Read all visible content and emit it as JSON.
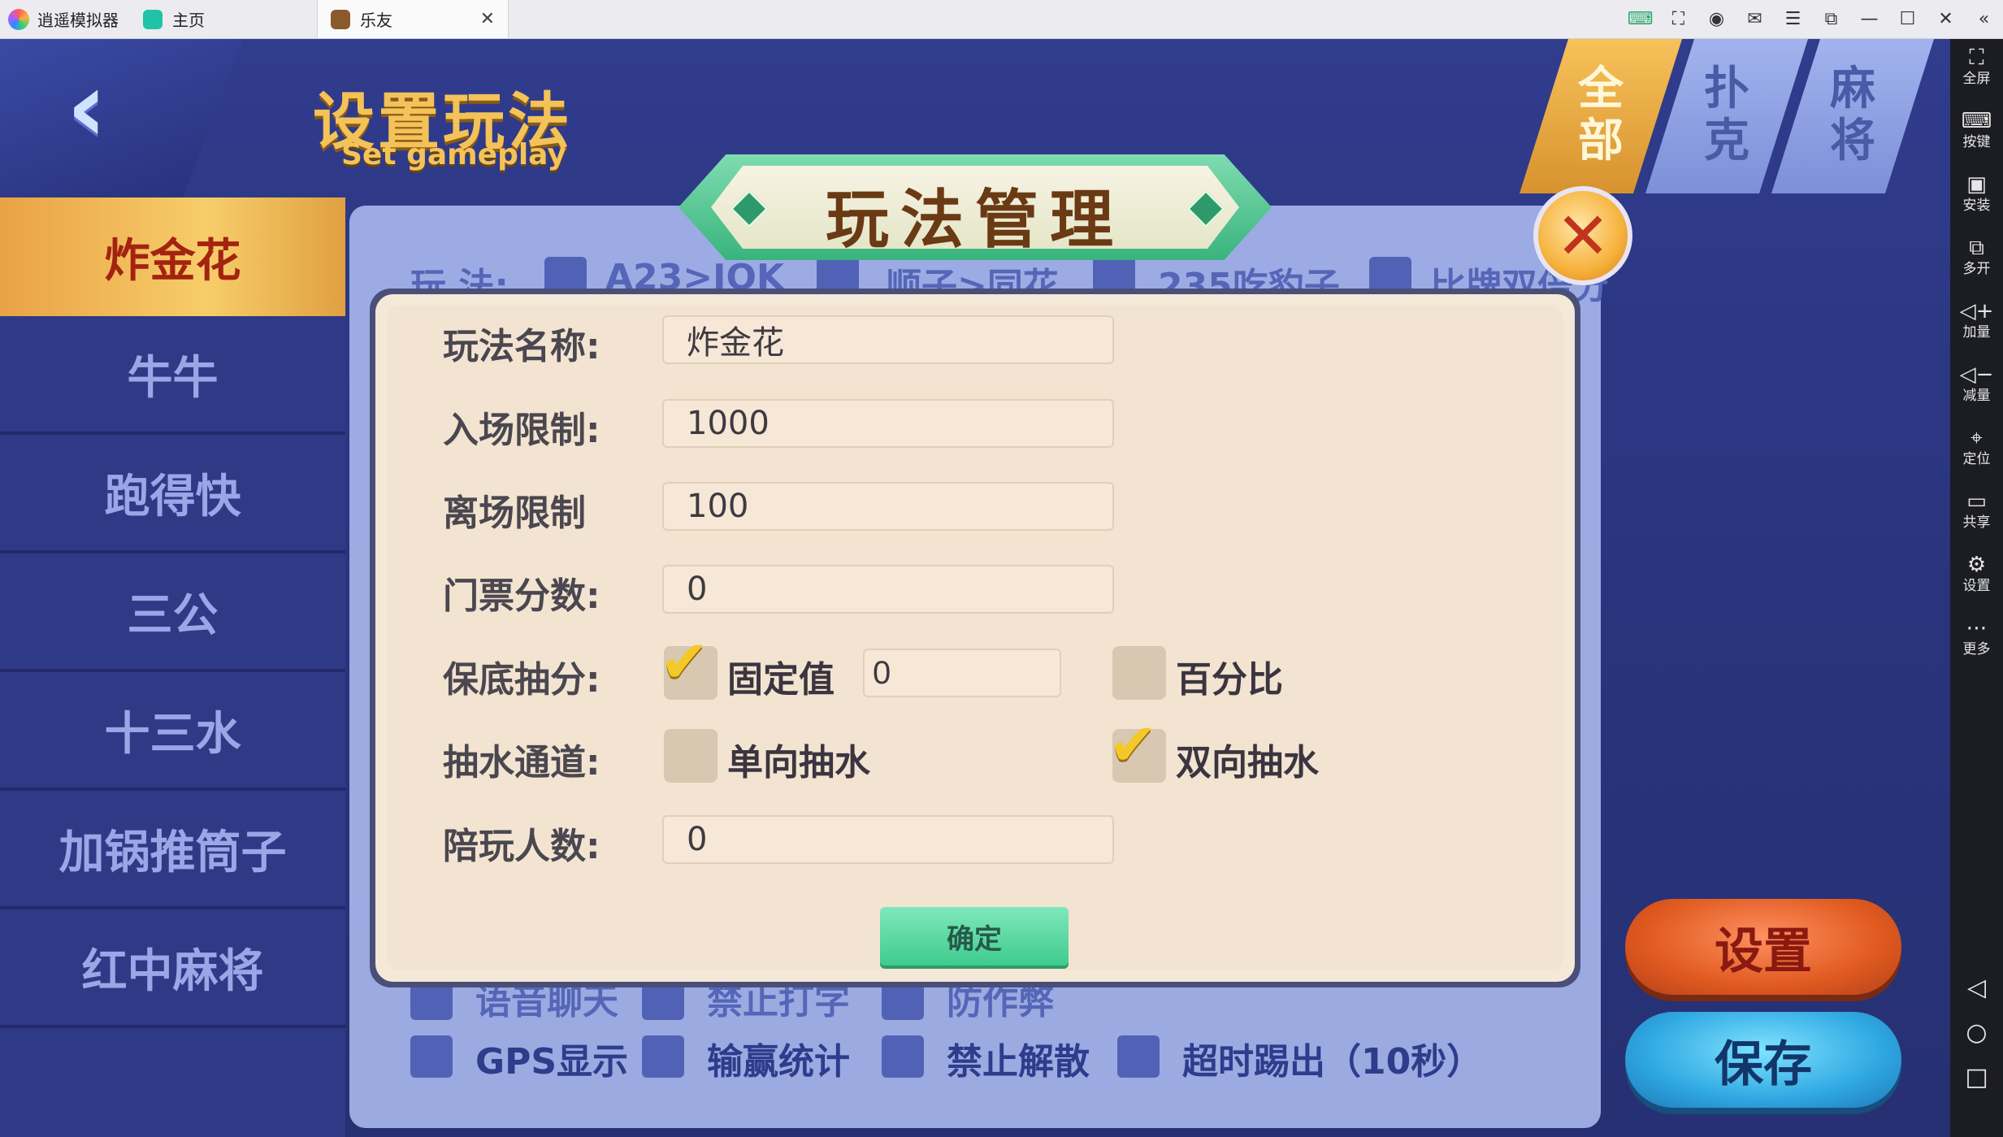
{
  "titlebar": {
    "app_name": "逍遥模拟器",
    "tabs": [
      {
        "label": "主页"
      },
      {
        "label": "乐友"
      }
    ]
  },
  "sidebar": {
    "items": [
      {
        "label": "全屏",
        "icon": "fullscreen-icon"
      },
      {
        "label": "按键",
        "icon": "keyboard-icon"
      },
      {
        "label": "安装",
        "icon": "apk-install-icon"
      },
      {
        "label": "多开",
        "icon": "multi-instance-icon"
      },
      {
        "label": "加量",
        "icon": "volume-up-icon"
      },
      {
        "label": "减量",
        "icon": "volume-down-icon"
      },
      {
        "label": "定位",
        "icon": "location-icon"
      },
      {
        "label": "共享",
        "icon": "folder-share-icon"
      },
      {
        "label": "设置",
        "icon": "settings-icon"
      },
      {
        "label": "更多",
        "icon": "more-icon"
      }
    ]
  },
  "header": {
    "title": "设置玩法",
    "subtitle": "Set gameplay",
    "category_tabs": [
      "全部",
      "扑克",
      "麻将"
    ]
  },
  "games": [
    {
      "label": "炸金花",
      "active": true
    },
    {
      "label": "牛牛"
    },
    {
      "label": "跑得快"
    },
    {
      "label": "三公"
    },
    {
      "label": "十三水"
    },
    {
      "label": "加锅推筒子"
    },
    {
      "label": "红中麻将"
    }
  ],
  "background": {
    "rule_label": "玩 法:",
    "rules": [
      "A23>JQK",
      "顺子>同花",
      "235吃豹子",
      "比牌双倍分"
    ],
    "options_row1": [
      "语音聊天",
      "禁止打字",
      "防作弊"
    ],
    "options_row2": [
      "GPS显示",
      "输赢统计",
      "禁止解散",
      "超时踢出（10秒）"
    ]
  },
  "buttons": {
    "settings": "设置",
    "save": "保存"
  },
  "modal": {
    "title": "玩法管理",
    "fields": {
      "name_label": "玩法名称:",
      "name_value": "炸金花",
      "entry_label": "入场限制:",
      "entry_value": "1000",
      "leave_label": "离场限制",
      "leave_value": "100",
      "ticket_label": "门票分数:",
      "ticket_value": "0",
      "guarantee_label": "保底抽分:",
      "fixed_label": "固定值",
      "fixed_value": "0",
      "percent_label": "百分比",
      "channel_label": "抽水通道:",
      "one_way_label": "单向抽水",
      "two_way_label": "双向抽水",
      "companion_label": "陪玩人数:",
      "companion_value": "0"
    },
    "state": {
      "fixed_checked": true,
      "percent_checked": false,
      "one_way_checked": false,
      "two_way_checked": true
    },
    "confirm": "确定"
  }
}
